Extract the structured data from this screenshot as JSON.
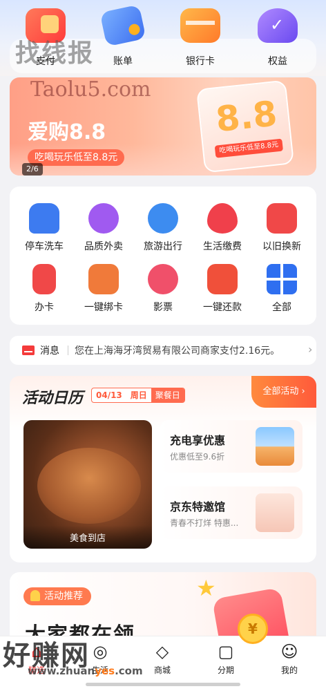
{
  "quick_bar": {
    "items": [
      {
        "label": "支付",
        "icon": "pay-icon"
      },
      {
        "label": "账单",
        "icon": "bill-icon"
      },
      {
        "label": "银行卡",
        "icon": "bank-card-icon"
      },
      {
        "label": "权益",
        "icon": "benefits-icon"
      }
    ]
  },
  "watermarks": {
    "top": "找线报",
    "site": "Taolu5.com",
    "bottom": "好赚网",
    "bottom_url_a": "www.zhuan",
    "bottom_url_b": "yes",
    "bottom_url_c": ".com"
  },
  "banner": {
    "title": "爱购8.8",
    "subtitle": "吃喝玩乐低至8.8元",
    "pager": "2/6",
    "box_text": "8.8",
    "box_tag": "吃喝玩乐低至8.8元"
  },
  "services": [
    {
      "label": "停车洗车",
      "icon": "car-icon",
      "color": "#3d7bf0"
    },
    {
      "label": "品质外卖",
      "icon": "scooter-icon",
      "color": "#a05af0"
    },
    {
      "label": "旅游出行",
      "icon": "palm-tree-icon",
      "color": "#3d8cf0"
    },
    {
      "label": "生活缴费",
      "icon": "flame-icon",
      "color": "#f0404b"
    },
    {
      "label": "以旧换新",
      "icon": "trade-in-icon",
      "color": "#f04848"
    },
    {
      "label": "办卡",
      "icon": "card-apply-icon",
      "color": "#f04848"
    },
    {
      "label": "一键绑卡",
      "icon": "bind-card-icon",
      "color": "#f07a3a"
    },
    {
      "label": "影票",
      "icon": "film-reel-icon",
      "color": "#f0506a"
    },
    {
      "label": "一键还款",
      "icon": "repay-icon",
      "color": "#f0503a"
    },
    {
      "label": "全部",
      "icon": "grid-icon",
      "color": "#2f6ff0"
    }
  ],
  "message": {
    "title": "消息",
    "content": "您在上海海牙湾贸易有限公司商家支付2.16元。",
    "chevron": "›"
  },
  "calendar": {
    "title": "活动日历",
    "date": "04/13",
    "weekday": "周日",
    "festival": "聚餐日",
    "all_label": "全部活动 ›",
    "food_caption": "美食到店",
    "promos": [
      {
        "title": "充电享优惠",
        "subtitle": "优惠低至9.6折",
        "icon": "ev-car-icon"
      },
      {
        "title": "京东特邀馆",
        "subtitle": "青春不打烊 特惠...",
        "icon": "jd-product-icon"
      }
    ]
  },
  "recommend": {
    "badge": "活动推荐",
    "headline": "大家都在领",
    "coin": "¥"
  },
  "nav": {
    "items": [
      {
        "label": "精选",
        "icon": "home-icon",
        "glyph": "⌂",
        "active": true
      },
      {
        "label": "生活",
        "icon": "life-icon",
        "glyph": "◎",
        "active": false
      },
      {
        "label": "商城",
        "icon": "diamond-icon",
        "glyph": "◇",
        "active": false
      },
      {
        "label": "分期",
        "icon": "bag-icon",
        "glyph": "▢",
        "active": false
      },
      {
        "label": "我的",
        "icon": "smile-icon",
        "glyph": "☺",
        "active": false
      }
    ]
  }
}
